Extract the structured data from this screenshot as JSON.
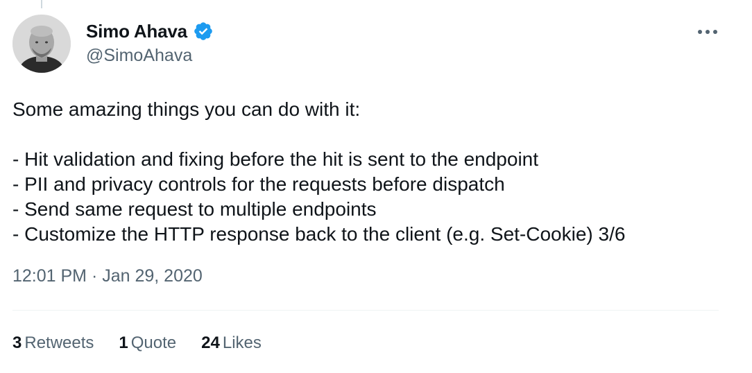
{
  "author": {
    "display_name": "Simo Ahava",
    "handle": "@SimoAhava",
    "verified": true,
    "verified_color": "#1d9bf0"
  },
  "tweet": {
    "lines": [
      "Some amazing things you can do with it:",
      "",
      "- Hit validation and fixing before the hit is sent to the endpoint",
      "- PII and privacy controls for the requests before dispatch",
      "- Send same request to multiple endpoints",
      "- Customize the HTTP response back to the client (e.g. Set-Cookie) 3/6"
    ],
    "timestamp": "12:01 PM · Jan 29, 2020"
  },
  "stats": {
    "retweets_count": "3",
    "retweets_label": "Retweets",
    "quotes_count": "1",
    "quotes_label": "Quote",
    "likes_count": "24",
    "likes_label": "Likes"
  },
  "icons": {
    "verified": "verified-badge-icon",
    "more": "more-options-icon"
  },
  "colors": {
    "text_primary": "#0f1419",
    "text_secondary": "#536471",
    "divider": "#eff3f4"
  }
}
